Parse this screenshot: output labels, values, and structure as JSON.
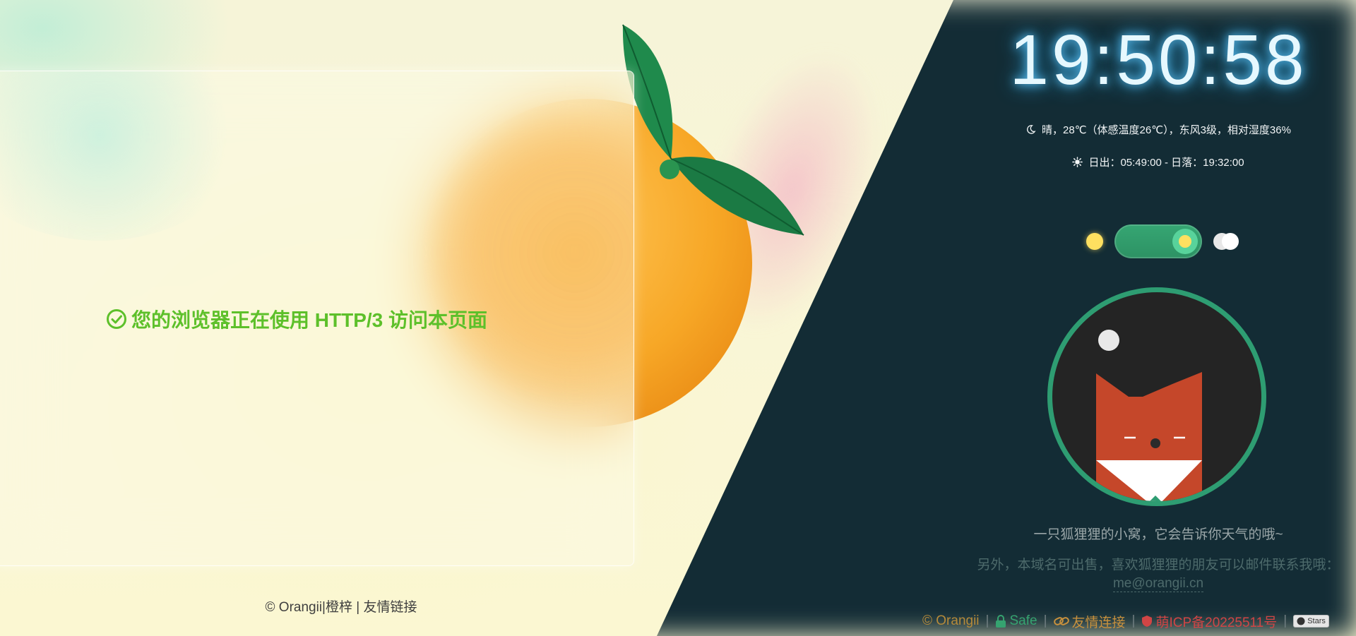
{
  "clock": {
    "time": "19:50:58"
  },
  "weather": {
    "text": "晴，28℃（体感温度26℃），东风3级，相对湿度36%",
    "icon": "moon-icon"
  },
  "sun": {
    "text": "日出：05:49:00 - 日落：19:32:00",
    "icon": "sun-gear-icon"
  },
  "theme_toggle": {
    "state": "on"
  },
  "main": {
    "http3_message": "您的浏览器正在使用 HTTP/3 访问本页面",
    "http3_color": "#5dc02a"
  },
  "left_footer": {
    "text": "© Orangii|橙梓 | 友情链接"
  },
  "right": {
    "tagline": "一只狐狸狸的小窝，它会告诉你天气的哦~",
    "sale_text": "另外，本域名可出售，喜欢狐狸狸的朋友可以邮件联系我哦：",
    "sale_email": "me@orangii.cn"
  },
  "bottom_bar": {
    "copyright": "© Orangii",
    "safe": "Safe",
    "friends": "友情连接",
    "icp": "萌ICP备20225511号",
    "stars": "Stars",
    "separator": "|"
  },
  "colors": {
    "accent_green": "#2e9d72",
    "dark_bg": "#132c35",
    "clock_glow": "#5fc9ff"
  }
}
